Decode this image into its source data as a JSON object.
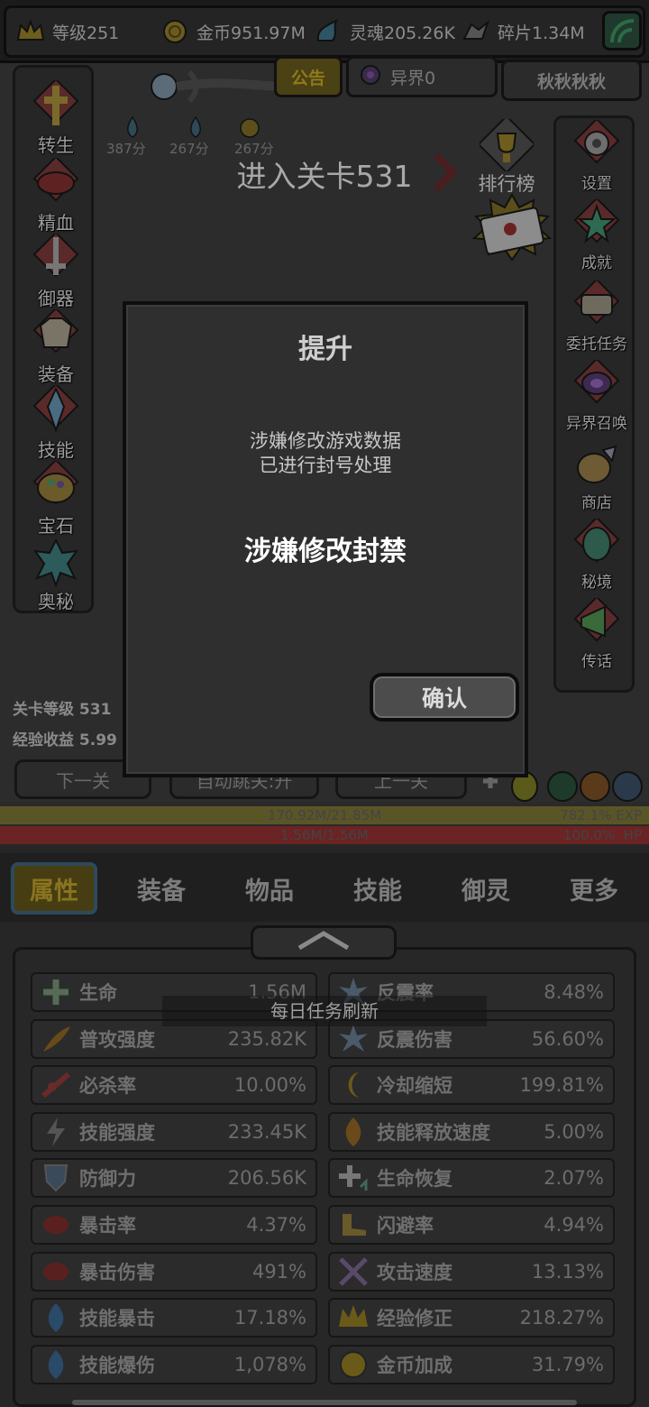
{
  "resources": {
    "level": "等级251",
    "gold": "金币951.97M",
    "soul": "灵魂205.26K",
    "shard": "碎片1.34M"
  },
  "header_tabs": {
    "notice": "公告",
    "otherworld": "异界0",
    "player_name": "秋秋秋秋"
  },
  "scores": [
    "387分",
    "267分",
    "267分"
  ],
  "stage_title": "进入关卡531",
  "ranking": "排行榜",
  "left_menu": [
    "转生",
    "精血",
    "御器",
    "装备",
    "技能",
    "宝石",
    "奥秘"
  ],
  "right_menu": [
    "设置",
    "成就",
    "委托任务",
    "异界召唤",
    "商店",
    "秘境",
    "传话"
  ],
  "stage_info": {
    "level_label": "关卡等级 531",
    "exp_label": "经验收益 5.99"
  },
  "stage_buttons": {
    "next": "下一关",
    "auto": "自动跳关:开",
    "prev": "上一关"
  },
  "exp_bar": {
    "value": "170.92M/21.85M",
    "percent": "782.1%",
    "label": "EXP",
    "fill": 1.0
  },
  "hp_bar": {
    "value": "1.56M/1.56M",
    "percent": "100.0%",
    "label": "HP",
    "fill": 1.0
  },
  "bottom_tabs": [
    "属性",
    "装备",
    "物品",
    "技能",
    "御灵",
    "更多"
  ],
  "active_tab": "属性",
  "toast": "每日任务刷新",
  "stats": [
    {
      "name": "生命",
      "value": "1.56M"
    },
    {
      "name": "反震率",
      "value": "8.48%"
    },
    {
      "name": "普攻强度",
      "value": "235.82K"
    },
    {
      "name": "反震伤害",
      "value": "56.60%"
    },
    {
      "name": "必杀率",
      "value": "10.00%"
    },
    {
      "name": "冷却缩短",
      "value": "199.81%"
    },
    {
      "name": "技能强度",
      "value": "233.45K"
    },
    {
      "name": "技能释放速度",
      "value": "5.00%"
    },
    {
      "name": "防御力",
      "value": "206.56K"
    },
    {
      "name": "生命恢复",
      "value": "2.07%"
    },
    {
      "name": "暴击率",
      "value": "4.37%"
    },
    {
      "name": "闪避率",
      "value": "4.94%"
    },
    {
      "name": "暴击伤害",
      "value": "491%"
    },
    {
      "name": "攻击速度",
      "value": "13.13%"
    },
    {
      "name": "技能暴击",
      "value": "17.18%"
    },
    {
      "name": "经验修正",
      "value": "218.27%"
    },
    {
      "name": "技能爆伤",
      "value": "1,078%"
    },
    {
      "name": "金币加成",
      "value": "31.79%"
    }
  ],
  "dialog": {
    "title": "提升",
    "message_line1": "涉嫌修改游戏数据",
    "message_line2": "已进行封号处理",
    "ban_text": "涉嫌修改封禁",
    "confirm": "确认"
  },
  "colors": {
    "exp_bar": "#5a5526",
    "hp_bar": "#6b2323",
    "active_tab_bg": "#463d12",
    "active_tab_text": "#8a7420"
  }
}
